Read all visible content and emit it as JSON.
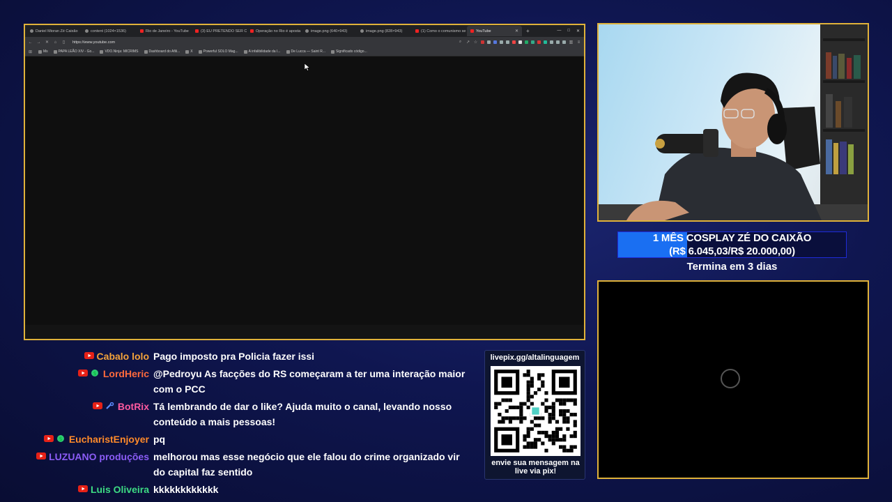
{
  "browser": {
    "tabs": [
      {
        "label": "Daniel Mioran Zé Caixão",
        "icon": "globe-icon",
        "active": false
      },
      {
        "label": "content (1024×1536)",
        "icon": "globe-icon",
        "active": false
      },
      {
        "label": "Rio de Janeiro - YouTube",
        "icon": "youtube-icon",
        "active": false
      },
      {
        "label": "(3) EU PRETENDO SER CAI",
        "icon": "youtube-icon",
        "active": false
      },
      {
        "label": "Operação no Rio é aposta",
        "icon": "youtube-icon",
        "active": false
      },
      {
        "label": "image.png (640×943)",
        "icon": "globe-icon",
        "active": false
      },
      {
        "label": "image.png (828×943)",
        "icon": "globe-icon",
        "active": false
      },
      {
        "label": "(1) Como o comunismo se",
        "icon": "youtube-icon",
        "active": false
      },
      {
        "label": "YouTube",
        "icon": "youtube-icon",
        "active": true
      }
    ],
    "url": "https://www.youtube.com",
    "bookmarks": [
      "Ms",
      "PAPA LEÃO XIV - Go...",
      "VDO.Ninja: MICRIMS",
      "Dashboard do Afili...",
      "X",
      "Powerful SOLO Mag...",
      "A infalibilidade da I...",
      "De Lucca — Saint R...",
      "Significado código..."
    ]
  },
  "goal": {
    "line1": "1 MÊS COSPLAY ZÉ DO CAIXÃO",
    "line2": "(R$ 6.045,03/R$ 20.000,00)",
    "progress": 0.302,
    "subtitle": "Termina em 3 dias",
    "fill_color": "#1a6ff2"
  },
  "chat": [
    {
      "user": "Cabalo lolo",
      "color": "#f5a33a",
      "badges": [
        "youtube-icon"
      ],
      "text": "Pago imposto pra Policia fazer issi"
    },
    {
      "user": "LordHeric",
      "color": "#ff6a3d",
      "badges": [
        "youtube-icon",
        "dollar-icon"
      ],
      "text": "@Pedroyu As facções do RS começaram a ter uma interação maior com o PCC"
    },
    {
      "user": "BotRix",
      "color": "#ff5aa0",
      "badges": [
        "youtube-icon",
        "wrench-icon"
      ],
      "text": "Tá lembrando de dar o like? Ajuda muito o canal, levando nosso conteúdo a mais pessoas!"
    },
    {
      "user": "EucharistEnjoyer",
      "color": "#ff8a2a",
      "badges": [
        "youtube-icon",
        "dollar-icon"
      ],
      "text": "pq"
    },
    {
      "user": "LUZUANO produções",
      "color": "#8b5cf6",
      "badges": [
        "youtube-icon"
      ],
      "text": "melhorou mas esse negócio que ele falou do crime organizado vir do capital faz sentido"
    },
    {
      "user": "Luis Oliveira",
      "color": "#3ddc84",
      "badges": [
        "youtube-icon"
      ],
      "text": "kkkkkkkkkkkk"
    }
  ],
  "pix": {
    "title": "livepix.gg/altalinguagem",
    "footer": "envie sua mensagem na live via pix!"
  }
}
